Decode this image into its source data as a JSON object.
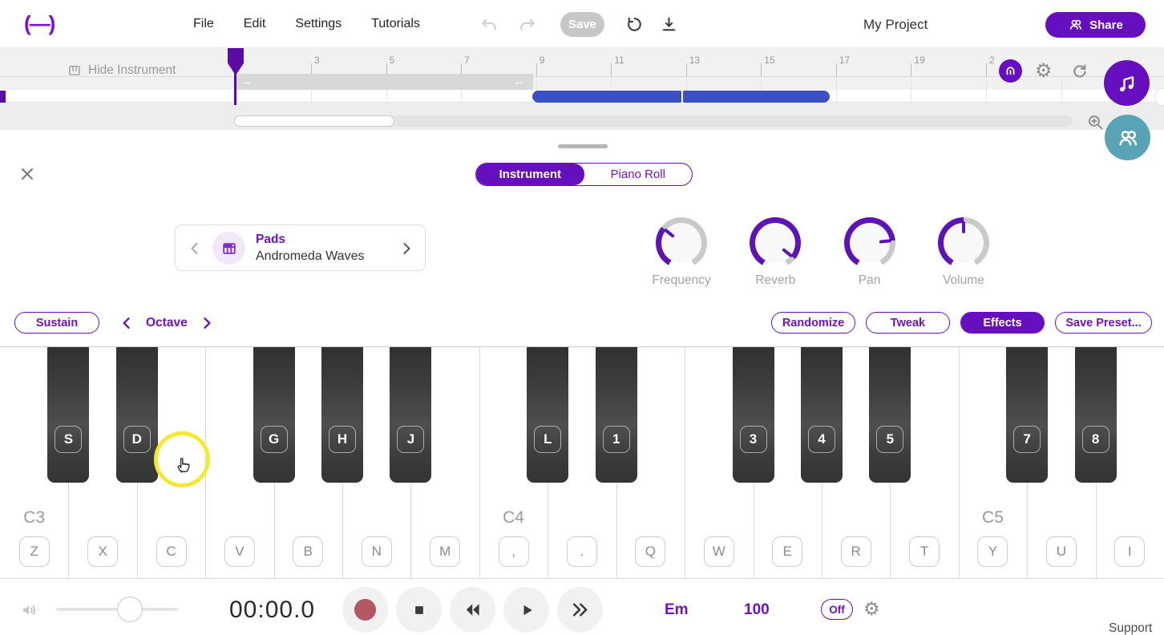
{
  "topbar": {
    "logo": "(—)",
    "menu": [
      "File",
      "Edit",
      "Settings",
      "Tutorials"
    ],
    "save_label": "Save",
    "project_title": "My Project",
    "share_label": "Share"
  },
  "timeline": {
    "hide_instrument_label": "Hide Instrument",
    "ruler_labels": [
      "3",
      "5",
      "7",
      "9",
      "11",
      "13",
      "15",
      "17",
      "19",
      "2"
    ]
  },
  "panel": {
    "tabs": {
      "instrument": "Instrument",
      "piano_roll": "Piano Roll"
    },
    "instrument_selector": {
      "category": "Pads",
      "name": "Andromeda Waves"
    },
    "knobs": [
      {
        "label": "Frequency",
        "percent": 33
      },
      {
        "label": "Reverb",
        "percent": 93
      },
      {
        "label": "Pan",
        "percent": 78
      },
      {
        "label": "Volume",
        "percent": 50
      }
    ],
    "controls": {
      "sustain": "Sustain",
      "octave": "Octave",
      "randomize": "Randomize",
      "tweak": "Tweak",
      "effects": "Effects",
      "save_preset": "Save Preset..."
    }
  },
  "keyboard": {
    "white_key_labels": [
      "Z",
      "X",
      "C",
      "V",
      "B",
      "N",
      "M",
      ",",
      ".",
      "Q",
      "W",
      "E",
      "R",
      "T",
      "Y",
      "U",
      "I"
    ],
    "black_keys": [
      {
        "label": "S",
        "boundary": 1
      },
      {
        "label": "D",
        "boundary": 2
      },
      {
        "label": "G",
        "boundary": 4
      },
      {
        "label": "H",
        "boundary": 5
      },
      {
        "label": "J",
        "boundary": 6
      },
      {
        "label": "L",
        "boundary": 8
      },
      {
        "label": "1",
        "boundary": 9
      },
      {
        "label": "3",
        "boundary": 11
      },
      {
        "label": "4",
        "boundary": 12
      },
      {
        "label": "5",
        "boundary": 13
      },
      {
        "label": "7",
        "boundary": 15
      },
      {
        "label": "8",
        "boundary": 16
      }
    ],
    "octave_labels": [
      {
        "text": "C3",
        "white_index": 0
      },
      {
        "text": "C4",
        "white_index": 7
      },
      {
        "text": "C5",
        "white_index": 14
      }
    ]
  },
  "transport": {
    "time": "00:00.0",
    "key_signature": "Em",
    "tempo": "100",
    "metronome_label": "Off"
  },
  "footer": {
    "support": "Support"
  },
  "colors": {
    "purple": "#650fc0",
    "purple_text": "#6d13c4",
    "teal": "#58a4b6",
    "clip_blue": "#3a50c3",
    "record_red": "#b15862",
    "highlight_yellow": "#f6e832",
    "black_key": "#3a3a3a"
  }
}
